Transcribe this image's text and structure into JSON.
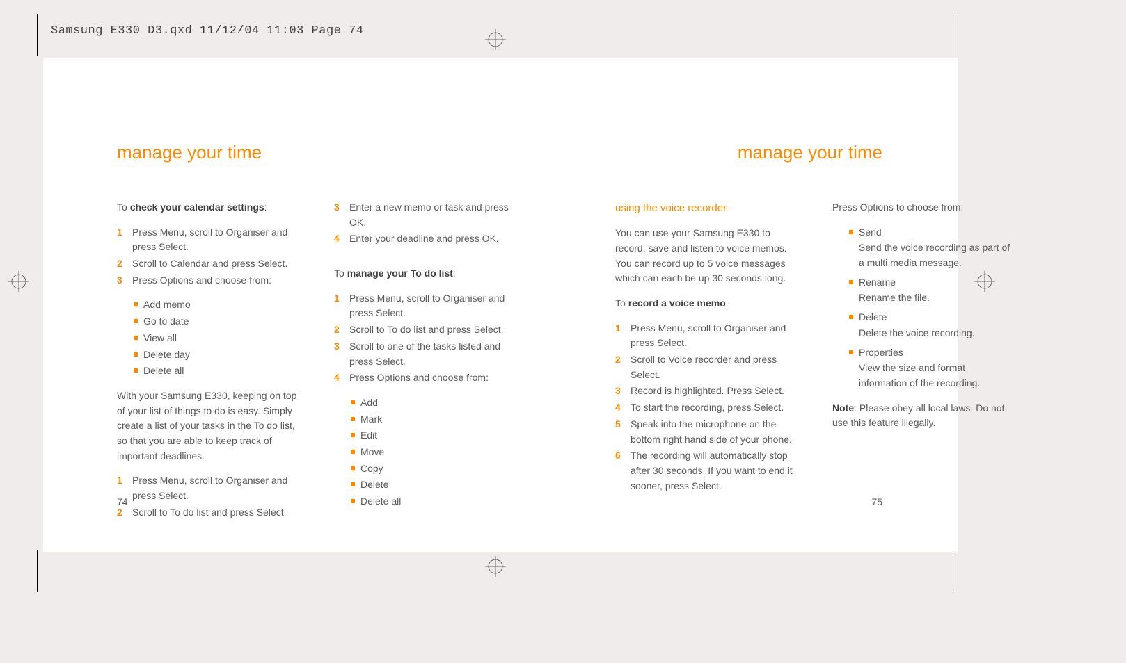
{
  "slug": "Samsung E330 D3.qxd  11/12/04  11:03  Page 74",
  "heading_left": "manage your time",
  "heading_right": "manage your time",
  "page_left_num": "74",
  "page_right_num": "75",
  "col1": {
    "intro_prefix": "To ",
    "intro_bold": "check your calendar settings",
    "intro_suffix": ":",
    "steps": [
      "Press Menu, scroll to Organiser and press Select.",
      "Scroll to Calendar and press Select.",
      "Press Options and choose from:"
    ],
    "bullets": [
      "Add memo",
      "Go to date",
      "View all",
      "Delete day",
      "Delete all"
    ],
    "para": "With your Samsung E330, keeping on top of your list of things to do is easy. Simply create a list of your tasks in the To do list, so that you are able to keep track of important deadlines.",
    "steps2": [
      "Press Menu, scroll to Organiser and press Select.",
      "Scroll to To do list and press Select."
    ]
  },
  "col2": {
    "steps_cont": [
      {
        "n": "3",
        "t": "Enter a new memo or task and press OK."
      },
      {
        "n": "4",
        "t": "Enter your deadline and press OK."
      }
    ],
    "intro_prefix": "To ",
    "intro_bold": "manage your To do list",
    "intro_suffix": ":",
    "steps": [
      "Press Menu, scroll to Organiser and press Select.",
      "Scroll to To do list and press Select.",
      "Scroll to one of the tasks listed and press Select.",
      "Press Options and choose from:"
    ],
    "bullets": [
      "Add",
      "Mark",
      "Edit",
      "Move",
      "Copy",
      "Delete",
      "Delete all"
    ]
  },
  "col3": {
    "title": "using the voice recorder",
    "para": "You can use your Samsung E330 to record, save and listen to voice memos. You can record up to 5 voice messages which can each be up 30 seconds long.",
    "intro_prefix": "To ",
    "intro_bold": "record a voice memo",
    "intro_suffix": ":",
    "steps": [
      "Press Menu, scroll to Organiser and press Select.",
      "Scroll to Voice recorder and press Select.",
      "Record is highlighted. Press Select.",
      "To start the recording, press Select.",
      "Speak into the microphone on the bottom right hand side of your phone.",
      "The recording will automatically stop after 30 seconds. If you want to end it sooner, press Select."
    ]
  },
  "col4": {
    "intro": "Press Options to choose from:",
    "items": [
      {
        "title": "Send",
        "desc": "Send the voice recording as part of a multi media message."
      },
      {
        "title": "Rename",
        "desc": "Rename the file."
      },
      {
        "title": "Delete",
        "desc": "Delete the voice recording."
      },
      {
        "title": "Properties",
        "desc": "View the size and format information of the recording."
      }
    ],
    "note_prefix": "Note",
    "note_body": ": Please obey all local laws. Do not use this feature illegally."
  }
}
